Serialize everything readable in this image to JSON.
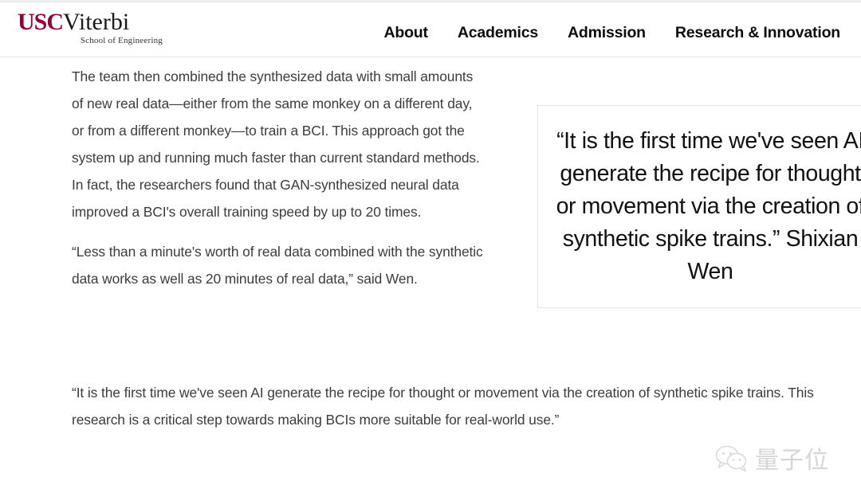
{
  "header": {
    "logo": {
      "usc": "USC",
      "viterbi": "Viterbi",
      "subtitle": "School of Engineering"
    },
    "nav": [
      {
        "label": "About"
      },
      {
        "label": "Academics"
      },
      {
        "label": "Admission"
      },
      {
        "label": "Research & Innovation"
      }
    ]
  },
  "article": {
    "paragraphs": [
      "The team then combined the synthesized data with small amounts of new real data—either from the same monkey on a different day, or from a different monkey—to train a BCI. This approach got the system up and running much faster than current standard methods. In fact, the researchers found that GAN-synthesized neural data improved a BCI's overall training speed by up to 20 times.",
      "“Less than a minute's worth of real data combined with the synthetic data works as well as 20 minutes of real data,” said Wen."
    ],
    "full_width_paragraph": "“It is the first time we've seen AI generate the recipe for thought or movement via the creation of synthetic spike trains. This research is a critical step towards making BCIs more suitable for real-world use.”",
    "pullquote": {
      "text": "“It is the first time we've seen AI generate the recipe for thought or movement via the creation of synthetic spike trains.” Shixian Wen",
      "border_color": "#e4e4e4"
    }
  },
  "watermark": {
    "icon": "wechat-bubbles-icon",
    "text": "量子位",
    "color": "#b5b5b5"
  },
  "colors": {
    "usc_cardinal": "#990033",
    "body_text": "#3c3c3c",
    "nav_text": "#0d0d0d",
    "page_background": "#ffffff"
  }
}
